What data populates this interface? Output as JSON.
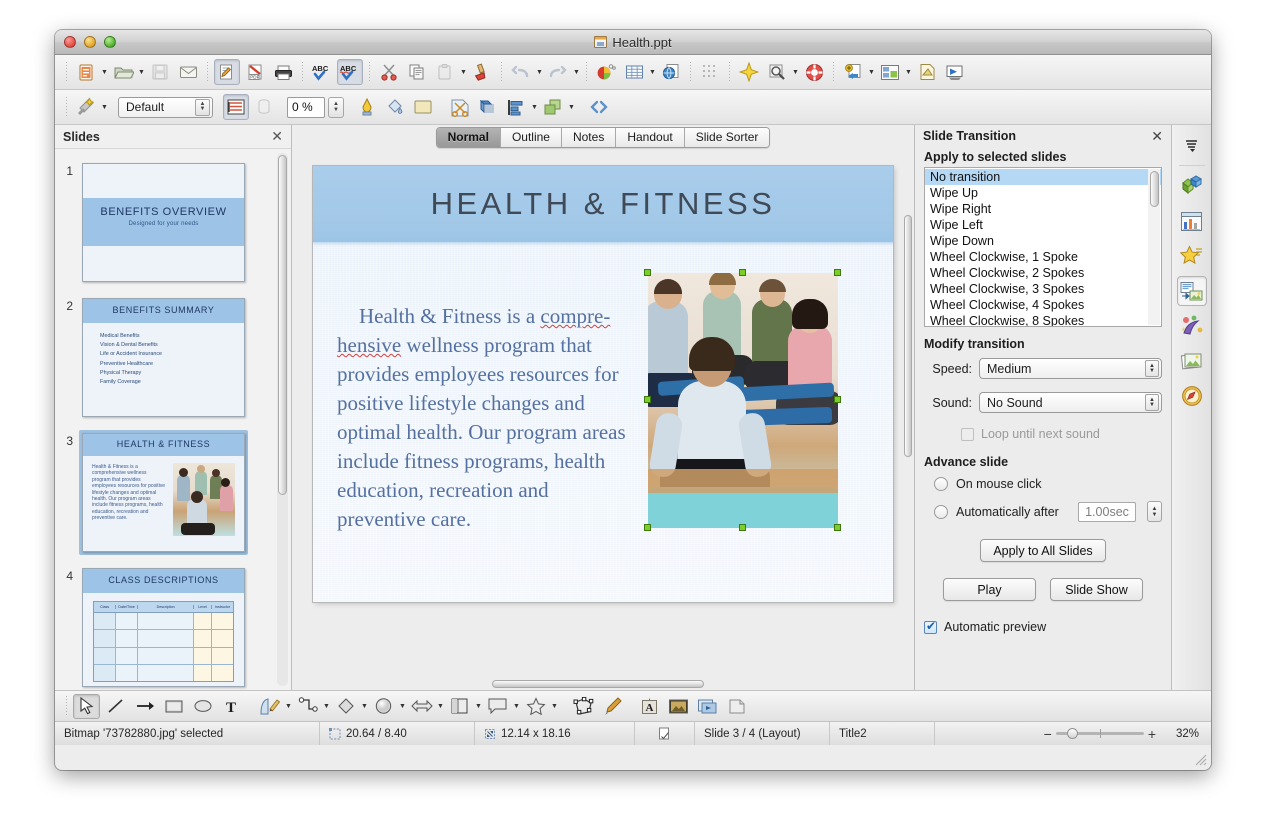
{
  "window": {
    "title": "Health.ppt",
    "title_icon": "presentation-file-icon",
    "traffic_lights": [
      "close",
      "minimize",
      "zoom"
    ]
  },
  "toolbar_main": {
    "items": [
      {
        "name": "new-document",
        "icon": "new-doc-icon",
        "dropdown": true
      },
      {
        "name": "open-document",
        "icon": "open-folder-icon",
        "dropdown": true
      },
      {
        "name": "save-document",
        "icon": "save-floppy-icon",
        "disabled": true
      },
      {
        "name": "email-document",
        "icon": "envelope-icon"
      },
      {
        "name": "edit-file",
        "icon": "edit-pencil-icon",
        "pressed": true
      },
      {
        "name": "export-pdf",
        "icon": "pdf-icon"
      },
      {
        "name": "print",
        "icon": "printer-icon"
      },
      {
        "name": "spelling",
        "icon": "abc-check-icon"
      },
      {
        "name": "autospellcheck",
        "icon": "abc-redcheck-icon",
        "pressed": true
      },
      {
        "name": "cut",
        "icon": "scissors-icon"
      },
      {
        "name": "copy",
        "icon": "copy-icon"
      },
      {
        "name": "paste",
        "icon": "clipboard-icon",
        "dropdown": true
      },
      {
        "name": "clone-formatting",
        "icon": "paintbrush-icon"
      },
      {
        "name": "undo",
        "icon": "undo-arrow-icon",
        "dropdown": true,
        "disabled": true
      },
      {
        "name": "redo",
        "icon": "redo-arrow-icon",
        "dropdown": true,
        "disabled": true
      },
      {
        "name": "insert-chart",
        "icon": "pie-chart-icon"
      },
      {
        "name": "insert-table",
        "icon": "table-grid-icon",
        "dropdown": true
      },
      {
        "name": "hyperlink",
        "icon": "globe-page-icon"
      },
      {
        "name": "display-grid",
        "icon": "grid-dots-icon"
      },
      {
        "name": "effects",
        "icon": "star-sparkle-icon"
      },
      {
        "name": "zoom",
        "icon": "magnifier-icon",
        "dropdown": true
      },
      {
        "name": "help",
        "icon": "lifering-icon"
      },
      {
        "name": "new-slide",
        "icon": "new-slide-icon",
        "dropdown": true
      },
      {
        "name": "slide-layout",
        "icon": "layout-icon",
        "dropdown": true
      },
      {
        "name": "slide-design",
        "icon": "slide-design-icon"
      },
      {
        "name": "start-slideshow",
        "icon": "projector-screen-icon"
      }
    ]
  },
  "toolbar_line_fill": {
    "style_label": "Default",
    "transparency_value": "0 %",
    "items": [
      {
        "name": "styles-wand",
        "icon": "magic-wand-icon",
        "dropdown": true
      },
      {
        "name": "line-style-dialog",
        "icon": "line-style-icon"
      },
      {
        "name": "line-width",
        "icon": "line-width-icon",
        "disabled": true
      },
      {
        "name": "transparency-spin",
        "icon": "spinner-icon"
      },
      {
        "name": "line-color",
        "icon": "line-color-icon"
      },
      {
        "name": "area-style-fill",
        "icon": "paint-can-icon"
      },
      {
        "name": "fill-color",
        "icon": "fill-color-swatch-icon"
      },
      {
        "name": "crop-image",
        "icon": "crop-scissors-icon"
      },
      {
        "name": "shadow",
        "icon": "shadow-icon"
      },
      {
        "name": "alignment",
        "icon": "align-icon",
        "dropdown": true
      },
      {
        "name": "arrange",
        "icon": "arrange-icon",
        "dropdown": true
      },
      {
        "name": "points",
        "icon": "points-icon"
      }
    ]
  },
  "slides_panel": {
    "title": "Slides",
    "close_icon": "close-icon",
    "slides": [
      {
        "number": "1",
        "selected": false,
        "kind": "title",
        "title": "BENEFITS OVERVIEW",
        "subtitle": "Designed for your needs"
      },
      {
        "number": "2",
        "selected": false,
        "kind": "bullets",
        "title": "BENEFITS SUMMARY",
        "bullets": [
          "Medical  Benefits",
          "Vision & Dental Benefits",
          "Life or Accident Insurance",
          "Preventive  Healthcare",
          "Physical  Therapy",
          "Family  Coverage"
        ]
      },
      {
        "number": "3",
        "selected": true,
        "kind": "text-image",
        "title": "HEALTH & FITNESS",
        "body": "Health & Fitness is a comprehensive wellness program that provides employees resources for positive lifestyle changes and optimal health. Our program areas include fitness programs, health education, recreation and preventive care."
      },
      {
        "number": "4",
        "selected": false,
        "kind": "table",
        "title": "CLASS DESCRIPTIONS",
        "table_headers": [
          "Class",
          "Date/Time",
          "Description",
          "Level",
          "Instructor"
        ]
      }
    ]
  },
  "view_tabs": {
    "tabs": [
      {
        "label": "Normal",
        "active": true
      },
      {
        "label": "Outline",
        "active": false
      },
      {
        "label": "Notes",
        "active": false
      },
      {
        "label": "Handout",
        "active": false
      },
      {
        "label": "Slide Sorter",
        "active": false
      }
    ]
  },
  "slide_editor": {
    "title": "HEALTH & FITNESS",
    "body_part1": "Health & Fitness is a ",
    "body_misspelled": "compre-hensive",
    "body_part2": " wellness program that provides employees resources for positive lifestyle changes and optimal health. Our program areas include fitness programs, health education, recreation and preventive care.",
    "image_name": "yoga-class-photo",
    "selection_handle_color": "#7ccf28"
  },
  "task_pane": {
    "title": "Slide Transition",
    "close_icon": "close-icon",
    "apply_heading": "Apply to selected slides",
    "transitions": [
      {
        "label": "No transition",
        "selected": true
      },
      {
        "label": "Wipe Up",
        "selected": false
      },
      {
        "label": "Wipe Right",
        "selected": false
      },
      {
        "label": "Wipe Left",
        "selected": false
      },
      {
        "label": "Wipe Down",
        "selected": false
      },
      {
        "label": "Wheel Clockwise, 1 Spoke",
        "selected": false
      },
      {
        "label": "Wheel Clockwise, 2 Spokes",
        "selected": false
      },
      {
        "label": "Wheel Clockwise, 3 Spokes",
        "selected": false
      },
      {
        "label": "Wheel Clockwise, 4 Spokes",
        "selected": false
      },
      {
        "label": "Wheel Clockwise, 8 Spokes",
        "selected": false
      }
    ],
    "modify_heading": "Modify transition",
    "speed_label": "Speed:",
    "speed_value": "Medium",
    "sound_label": "Sound:",
    "sound_value": "No Sound",
    "loop_label": "Loop until next sound",
    "loop_checked": false,
    "advance_heading": "Advance slide",
    "on_mouse_click_label": "On mouse click",
    "automatically_after_label": "Automatically after",
    "automatically_after_value": "1.00sec",
    "apply_all_label": "Apply to All Slides",
    "play_label": "Play",
    "slide_show_label": "Slide Show",
    "automatic_preview_label": "Automatic preview",
    "automatic_preview_checked": true,
    "accent_selection": "#b5d8f5"
  },
  "icon_strip": {
    "items": [
      {
        "name": "pane-menu",
        "icon": "hamburger-menu-icon",
        "active": false
      },
      {
        "name": "master-pages",
        "icon": "cube-blocks-icon",
        "active": false
      },
      {
        "name": "layouts",
        "icon": "chart-layout-icon",
        "active": false
      },
      {
        "name": "styles",
        "icon": "star-icon",
        "active": false
      },
      {
        "name": "slide-transition",
        "icon": "slide-transition-icon",
        "active": true
      },
      {
        "name": "custom-animation",
        "icon": "animation-icon",
        "active": false
      },
      {
        "name": "gallery",
        "icon": "gallery-photos-icon",
        "active": false
      },
      {
        "name": "navigator",
        "icon": "compass-icon",
        "active": false
      }
    ]
  },
  "draw_toolbar": {
    "items": [
      {
        "name": "select-tool",
        "icon": "arrow-cursor-icon",
        "pressed": true
      },
      {
        "name": "line-tool",
        "icon": "line-icon"
      },
      {
        "name": "arrow-tool",
        "icon": "arrow-line-icon"
      },
      {
        "name": "rectangle-tool",
        "icon": "rectangle-icon"
      },
      {
        "name": "ellipse-tool",
        "icon": "ellipse-icon"
      },
      {
        "name": "text-tool",
        "icon": "text-T-icon"
      },
      {
        "name": "curve-tool",
        "icon": "curve-pencil-icon",
        "dropdown": true
      },
      {
        "name": "connector-tool",
        "icon": "connector-icon",
        "dropdown": true
      },
      {
        "name": "basic-shapes",
        "icon": "diamond-shape-icon",
        "dropdown": true
      },
      {
        "name": "symbol-shapes",
        "icon": "smiley-circle-icon",
        "dropdown": true
      },
      {
        "name": "block-arrows",
        "icon": "block-arrow-icon",
        "dropdown": true
      },
      {
        "name": "flowchart",
        "icon": "flowchart-icon",
        "dropdown": true
      },
      {
        "name": "callouts",
        "icon": "callout-bubble-icon",
        "dropdown": true
      },
      {
        "name": "stars",
        "icon": "star-outline-icon",
        "dropdown": true
      },
      {
        "name": "edit-points",
        "icon": "edit-points-icon"
      },
      {
        "name": "glue-points",
        "icon": "gluepoint-icon"
      },
      {
        "name": "fontwork",
        "icon": "fontwork-A-icon"
      },
      {
        "name": "insert-image",
        "icon": "insert-image-icon"
      },
      {
        "name": "insert-media",
        "icon": "insert-media-icon"
      },
      {
        "name": "rotate",
        "icon": "rotate-icon"
      }
    ]
  },
  "status_bar": {
    "object_status": "Bitmap '73782880.jpg' selected",
    "position_icon": "position-icon",
    "position": "20.64 / 8.40",
    "size_icon": "size-icon",
    "size": "12.14 x 18.16",
    "modified_icon": "modified-doc-icon",
    "slide_info": "Slide 3 / 4 (Layout)",
    "master_name": "Title2",
    "zoom_out_icon": "minus-icon",
    "zoom_in_icon": "plus-icon",
    "zoom_level": "32%"
  }
}
